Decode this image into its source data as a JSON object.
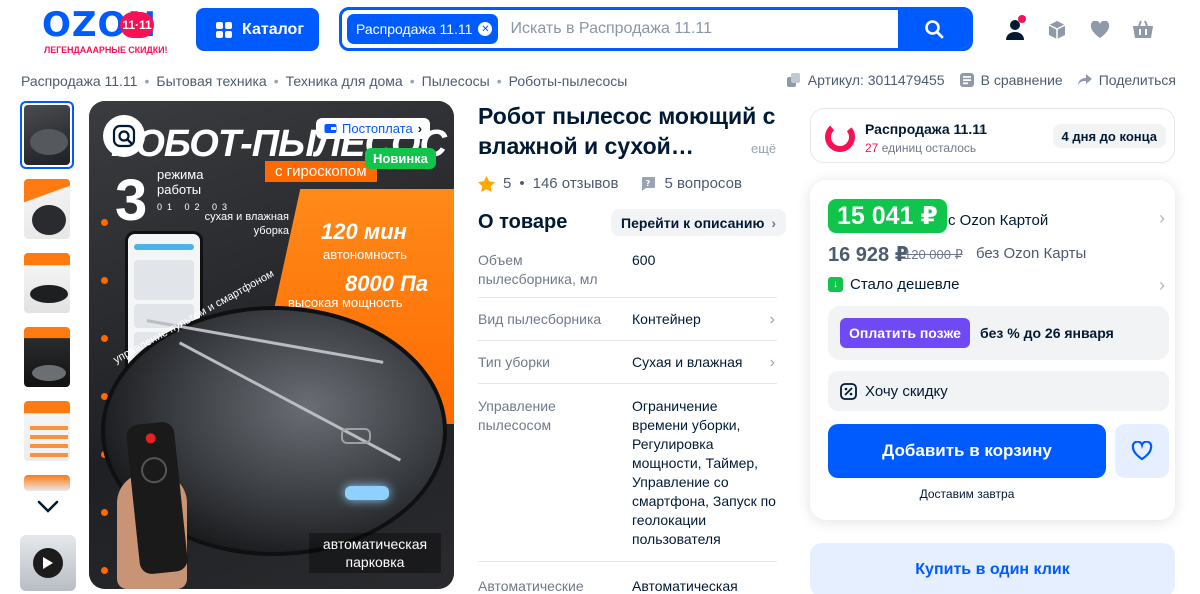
{
  "header": {
    "logo_text": "OZON",
    "logo_badge": "11·11",
    "logo_tagline": "ЛЕГЕНДАААРНЫЕ СКИДКИ!",
    "catalog_label": "Каталог",
    "search_chip": "Распродажа 11.11",
    "search_placeholder": "Искать в Распродажа 11.11",
    "icons": [
      "user-icon",
      "orders-box-icon",
      "heart-icon",
      "cart-icon"
    ]
  },
  "breadcrumb": [
    "Распродажа 11.11",
    "Бытовая техника",
    "Техника для дома",
    "Пылесосы",
    "Роботы-пылесосы"
  ],
  "meta": {
    "article": "Артикул: 3011479455",
    "compare": "В сравнение",
    "share": "Поделиться"
  },
  "gallery": {
    "badge_postpay": "Постоплата",
    "badge_new": "Новинка",
    "image_texts": {
      "title": "РОБОТ-ПЫЛЕСОС",
      "modes_num": "3",
      "modes_text": "режима работы",
      "modes_list": "01 02 03",
      "gyro": "с гироскопом",
      "dry_wet": "сухая и влажная уборка",
      "minutes": "120 мин",
      "autonomy": "автономность",
      "pascal": "8000 Па",
      "power": "высокая мощность",
      "control": "управление пультом и смартфоном",
      "parking": "автоматическая парковка"
    }
  },
  "product": {
    "title": "Робот пылесос моющий с влажной и сухой…",
    "more_label": "ещё",
    "rating": "5",
    "reviews": "146 отзывов",
    "questions": "5 вопросов",
    "about_title": "О товаре",
    "about_link": "Перейти к описанию",
    "specs": [
      {
        "key": "Объем пылесборника, мл",
        "value": "600"
      },
      {
        "key": "Вид пылесборника",
        "value": "Контейнер"
      },
      {
        "key": "Тип уборки",
        "value": "Сухая и влажная"
      },
      {
        "key": "Управление пылесосом",
        "value": "Ограничение времени уборки, Регулировка мощности, Таймер, Управление со смартфона, Запуск по геолокации пользователя"
      },
      {
        "key": "Автоматические",
        "value": "Автоматическая"
      }
    ]
  },
  "promo": {
    "title": "Распродажа 11.11",
    "left_count": "27",
    "left_text": "единиц осталось",
    "days": "4 дня до конца"
  },
  "buy": {
    "card_price": "15 041 ₽",
    "card_price_label": "с Ozon Картой",
    "regular_price": "16 928 ₽",
    "old_price": "120 000 ₽",
    "regular_label": "без Ozon Карты",
    "cheaper": "Стало дешевле",
    "pay_later_btn": "Оплатить позже",
    "pay_later_text": "без % до 26 января",
    "want_discount": "Хочу скидку",
    "add_to_cart": "Добавить в корзину",
    "delivery": "Доставим завтра",
    "one_click": "Купить в один клик"
  },
  "colors": {
    "brand": "#005bff",
    "accent_pink": "#f91155",
    "green": "#10c44c",
    "purple": "#6f4af4"
  }
}
